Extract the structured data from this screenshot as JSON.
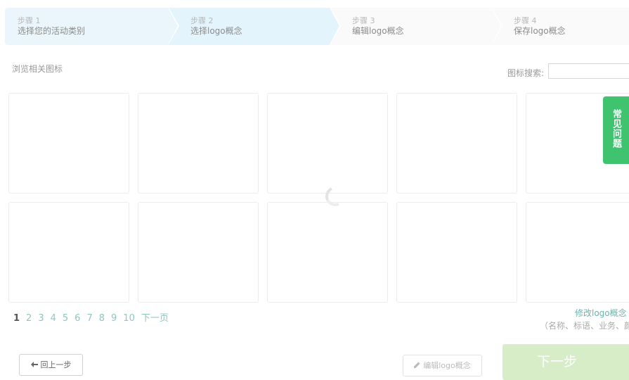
{
  "steps": [
    {
      "num": "步骤 1",
      "label": "选择您的活动类别"
    },
    {
      "num": "步骤 2",
      "label": "选择logo概念"
    },
    {
      "num": "步骤 3",
      "label": "编辑logo概念"
    },
    {
      "num": "步骤 4",
      "label": "保存logo概念"
    }
  ],
  "browse": {
    "title": "浏览相关图标",
    "search_label": "图标搜索:",
    "search_value": ""
  },
  "side_tab": {
    "label": "常见问题"
  },
  "pagination": {
    "pages": [
      "1",
      "2",
      "3",
      "4",
      "5",
      "6",
      "7",
      "8",
      "9",
      "10"
    ],
    "active": "1",
    "next_label": "下一页"
  },
  "modify": {
    "link": "修改logo概念",
    "note": "（名称、标语、业务、颜"
  },
  "buttons": {
    "back": "回上一步",
    "edit": "编辑logo概念",
    "next": "下一步"
  },
  "colors": {
    "accent_green": "#3fc36f",
    "next_button": "#d6edc8",
    "link_teal": "#8fc6c0"
  },
  "icons": {
    "back": "arrow-left-icon",
    "edit": "pencil-icon",
    "loading": "spinner-icon"
  }
}
